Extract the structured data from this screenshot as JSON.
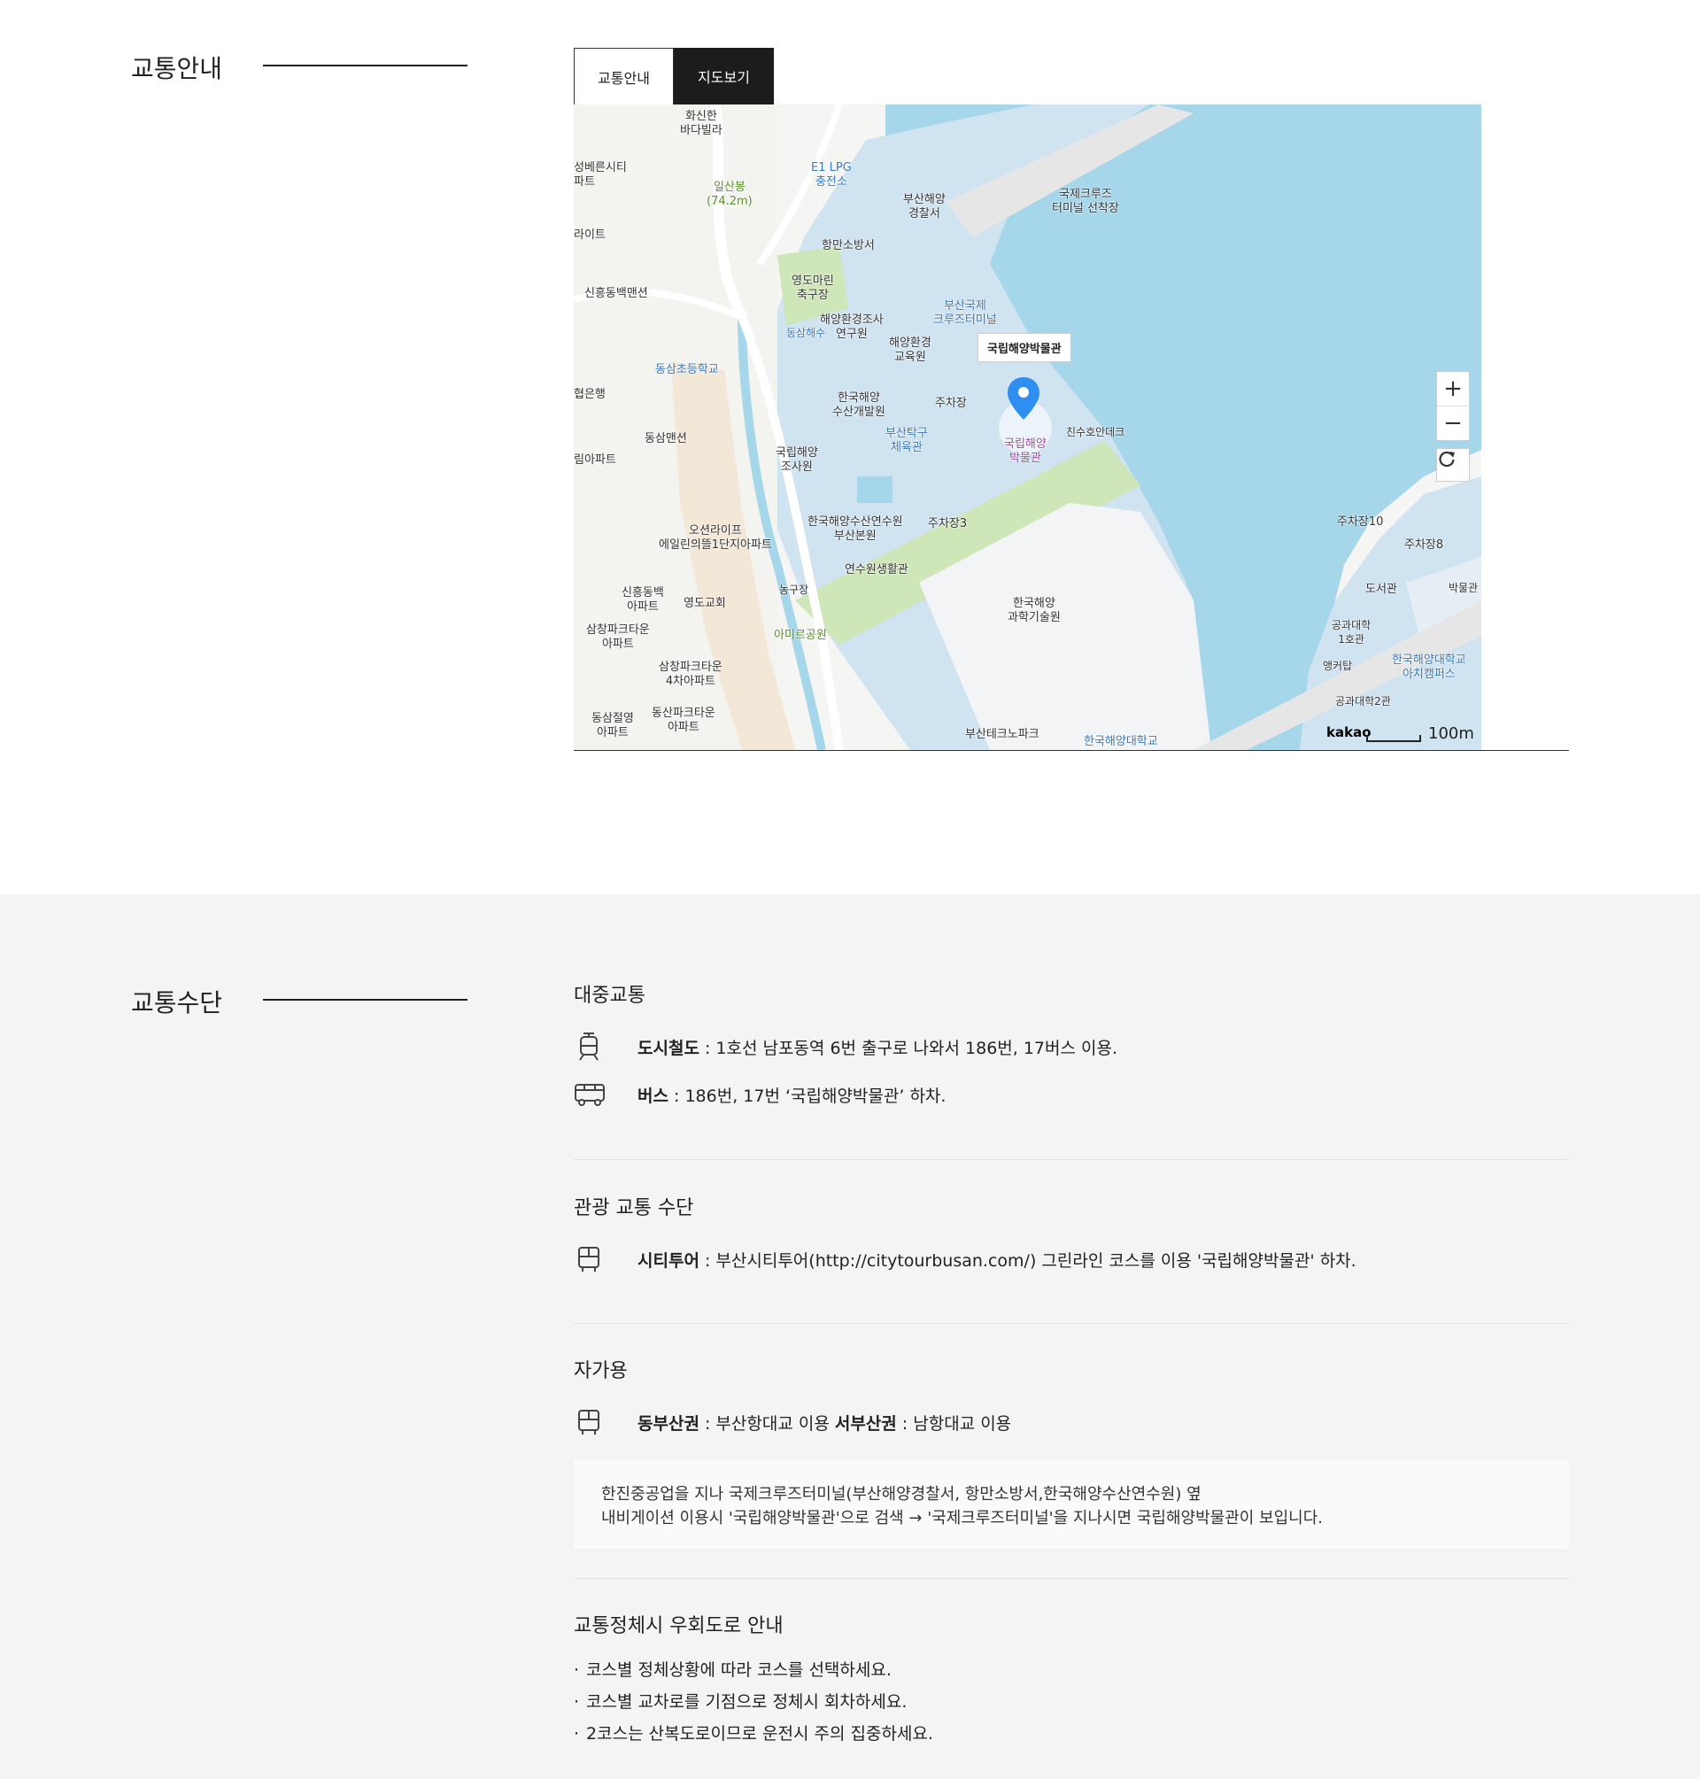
{
  "section1": {
    "title": "교통안내"
  },
  "tabs": [
    {
      "label": "교통안내",
      "active": false
    },
    {
      "label": "지도보기",
      "active": true
    }
  ],
  "map": {
    "info_label": "국립해양박물관",
    "zoom_in": "+",
    "zoom_out": "−",
    "logo": "kakao",
    "scale": "100m",
    "labels": [
      "화신한\n바다빌라",
      "성베른시티\n파트",
      "일산봉\n(74.2m)",
      "E1 LPG\n충전소",
      "부산해양\n경찰서",
      "국제크루즈\n터미널 선착장",
      "라이트",
      "항만소방서",
      "신흥동백맨션",
      "영도마린\n축구장",
      "부산국제\n크루즈터미널",
      "해양환경조사\n연구원",
      "동삼초등학교",
      "해양환경\n교육원",
      "협은행",
      "한국해양\n수산개발원",
      "주차장",
      "친수호안데크",
      "동삼맨션",
      "부산탁구\n체육관",
      "국립해양\n박물관",
      "국립해양\n조사원",
      "림아파트",
      "오션라이프\n에일린의뜰1단지아파트",
      "한국해양수산연수원\n부산본원",
      "주차장3",
      "주차장10",
      "주차장8",
      "연수원생활관",
      "신흥동백\n아파트",
      "영도교회",
      "농구장",
      "한국해양\n과학기술원",
      "도서관",
      "박물관",
      "공과대학\n1호관",
      "삼창파크타운\n아파트",
      "아미르공원",
      "앵커탑",
      "한국해양대학교\n아치캠퍼스",
      "삼창파크타운\n4차아파트",
      "공과대학2관",
      "동삼절영\n아파트",
      "동산파크타운\n아파트",
      "부산테크노파크",
      "한국해양대학교",
      "동삼해수"
    ]
  },
  "section2": {
    "title": "교통수단"
  },
  "public": {
    "heading": "대중교통",
    "subway": {
      "label": "도시철도",
      "text": " : 1호선 남포동역 6번 출구로 나와서 186번, 17버스 이용."
    },
    "bus": {
      "label": "버스",
      "text": " : 186번, 17번 ‘국립해양박물관’ 하차."
    }
  },
  "tour": {
    "heading": "관광 교통 수단",
    "citytour": {
      "label": "시티투어",
      "text": " : 부산시티투어(http://citytourbusan.com/) 그린라인 코스를 이용 '국립해양박물관' 하차."
    }
  },
  "car": {
    "heading": "자가용",
    "east_label": "동부산권",
    "east_text": " : 부산항대교 이용 ",
    "west_label": "서부산권",
    "west_text": " : 남항대교 이용",
    "note1": "한진중공업을 지나 국제크루즈터미널(부산해양경찰서, 항만소방서,한국해양수산연수원) 옆",
    "note2": "내비게이션 이용시 '국립해양박물관'으로 검색 → '국제크루즈터미널'을 지나시면 국립해양박물관이 보입니다."
  },
  "detour": {
    "heading": "교통정체시 우회도로 안내",
    "items": [
      "코스별 정체상황에 따라 코스를 선택하세요.",
      "코스별 교차로를 기점으로 정체시 회차하세요.",
      "2코스는 산복도로이므로 운전시 주의 집중하세요."
    ]
  }
}
